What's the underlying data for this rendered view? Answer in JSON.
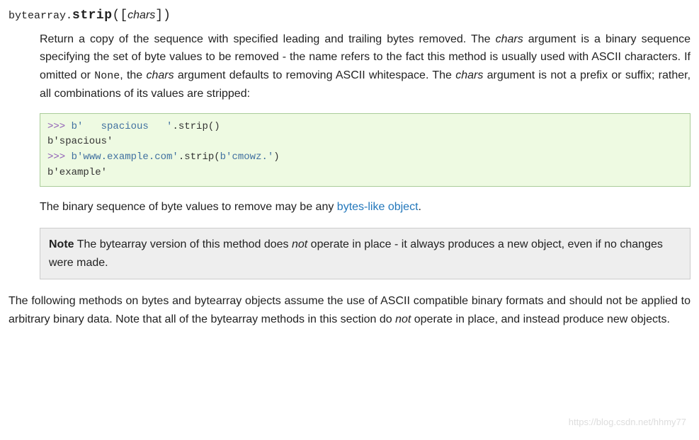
{
  "signature": {
    "class_prefix": "bytearray.",
    "method_name": "strip",
    "open": "(",
    "lbracket": "[",
    "param": "chars",
    "rbracket": "]",
    "close": ")"
  },
  "desc": {
    "t1": "Return a copy of the sequence with specified leading and trailing bytes removed. The ",
    "chars1": "chars",
    "t2": " argument is a binary sequence specifying the set of byte values to be removed - the name refers to the fact this method is usually used with ASCII characters. If omitted or ",
    "none_literal": "None",
    "t3": ", the ",
    "chars2": "chars",
    "t4": " argument defaults to removing ASCII whitespace. The ",
    "chars3": "chars",
    "t5": " argument is not a prefix or suffix; rather, all combinations of its values are stripped:"
  },
  "code": {
    "l1_prompt": ">>> ",
    "l1_str": "b'   spacious   '",
    "l1_call": ".strip()",
    "l2": "b'spacious'",
    "l3_prompt": ">>> ",
    "l3_str1": "b'www.example.com'",
    "l3_mid": ".strip(",
    "l3_str2": "b'cmowz.'",
    "l3_end": ")",
    "l4": "b'example'"
  },
  "after_code": {
    "t1": "The binary sequence of byte values to remove may be any ",
    "link": "bytes-like object",
    "t2": "."
  },
  "note": {
    "label": "Note",
    "t1": "  The bytearray version of this method does ",
    "not": "not",
    "t2": " operate in place - it always produces a new object, even if no changes were made."
  },
  "outro": {
    "t1": "The following methods on bytes and bytearray objects assume the use of ASCII compatible binary formats and should not be applied to arbitrary binary data. Note that all of the bytearray methods in this section do ",
    "not": "not",
    "t2": " operate in place, and instead produce new objects."
  },
  "watermark": "https://blog.csdn.net/hhmy77"
}
